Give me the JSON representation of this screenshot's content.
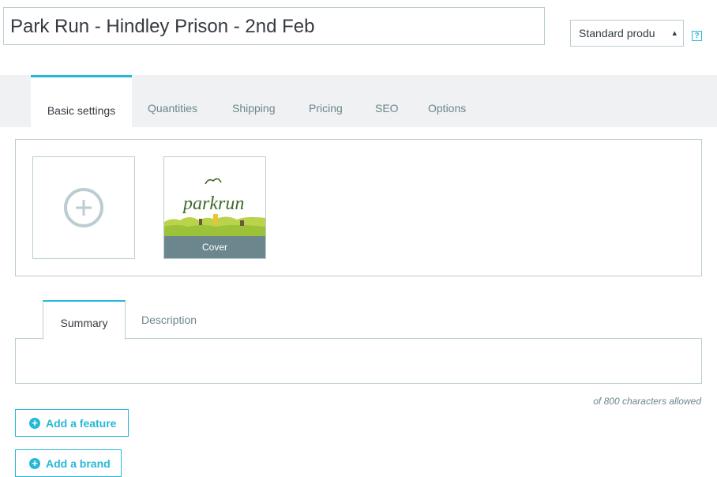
{
  "product": {
    "name": "Park Run - Hindley Prison - 2nd Feb",
    "type_selected": "Standard produ",
    "help_label": "?"
  },
  "main_tabs": [
    {
      "label": "Basic settings",
      "active": true
    },
    {
      "label": "Quantities"
    },
    {
      "label": "Shipping"
    },
    {
      "label": "Pricing"
    },
    {
      "label": "SEO"
    },
    {
      "label": "Options"
    }
  ],
  "images": {
    "cover_label": "Cover",
    "thumb_logo_text": "parkrun"
  },
  "description_tabs": [
    {
      "label": "Summary",
      "active": true
    },
    {
      "label": "Description"
    }
  ],
  "summary": {
    "value": "",
    "char_limit_text": "of 800 characters allowed"
  },
  "actions": {
    "add_feature": "Add a feature",
    "add_brand": "Add a brand"
  },
  "colors": {
    "accent": "#25b9d7",
    "border": "#bbcdd2",
    "muted": "#6c868e",
    "tabbar_bg": "#eff1f2"
  }
}
